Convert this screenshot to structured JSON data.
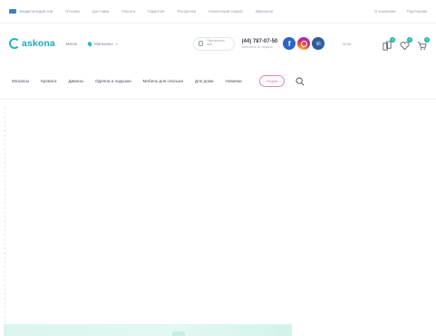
{
  "topbar": {
    "items": [
      "Энциклопедия сна",
      "Отзывы",
      "Доставка",
      "Оплата",
      "Гарантия",
      "Рассрочка",
      "Клиентский сервис",
      "Вакансии"
    ],
    "right_items": [
      "О компании",
      "Партнерам"
    ]
  },
  "header": {
    "logo_text": "askona",
    "menu_label": "Меню",
    "city_label": "Магазины",
    "callback_label": "Перезвонить мне",
    "phone": "(44) 787-07-50",
    "phone_sub": "Бесплатно по Украине",
    "blog_label": "Блог",
    "compare_count": "0",
    "wishlist_count": "0",
    "cart_count": "0",
    "colors": {
      "brand": "#21a9bf",
      "badge": "#1fb7a8",
      "promo": "#f27fa6"
    }
  },
  "nav": {
    "items": [
      "Матрасы",
      "Кровати",
      "Диваны",
      "Одеяла и подушки",
      "Мебель для спальни",
      "Для дома",
      "Новинки"
    ],
    "promo_label": "Акции"
  }
}
